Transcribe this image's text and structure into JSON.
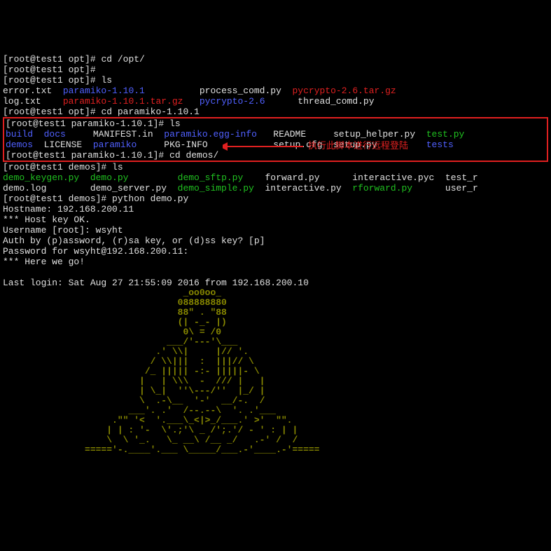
{
  "lines": {
    "l1_prompt": "[root@test1 opt]# ",
    "l1_cmd": "cd /opt/",
    "l2_prompt": "[root@test1 opt]# ",
    "l3_prompt": "[root@test1 opt]# ",
    "l3_cmd": "ls",
    "l4_a": "error.txt  ",
    "l4_b": "paramiko-1.10.1",
    "l4_c": "          process_comd.py  ",
    "l4_d": "pycrypto-2.6.tar.gz",
    "l5_a": "log.txt    ",
    "l5_b": "paramiko-1.10.1.tar.gz",
    "l5_c": "   ",
    "l5_d": "pycrypto-2.6",
    "l5_e": "      thread_comd.py",
    "l6_prompt": "[root@test1 opt]# ",
    "l6_cmd": "cd paramiko-1.10.1",
    "l7_prompt": "[root@test1 paramiko-1.10.1]# ",
    "l7_cmd": "ls",
    "l8_a": "build",
    "l8_b": "  ",
    "l8_c": "docs",
    "l8_d": "     MANIFEST.in  ",
    "l8_e": "paramiko.egg-info",
    "l8_f": "   README     setup_helper.py  ",
    "l8_g": "test.py",
    "l9_a": "demos",
    "l9_b": "  LICENSE  ",
    "l9_c": "paramiko",
    "l9_d": "     PKG-INFO            setup.cfg  setup.py         ",
    "l9_e": "tests",
    "l10_prompt": "[root@test1 paramiko-1.10.1]# ",
    "l10_cmd": "cd demos/",
    "l11_prompt": "[root@test1 demos]# ",
    "l11_cmd": "ls",
    "l12_a": "demo_keygen.py",
    "l12_b": "  ",
    "l12_c": "demo.py",
    "l12_d": "         ",
    "l12_e": "demo_sftp.py",
    "l12_f": "    forward.py      interactive.pyc  test_r",
    "l13_a": "demo.log        demo_server.py  ",
    "l13_b": "demo_simple.py",
    "l13_c": "  interactive.py  ",
    "l13_d": "rforward.py",
    "l13_e": "      user_r",
    "l14_prompt": "[root@test1 demos]# ",
    "l14_cmd": "python demo.py",
    "l15": "Hostname: 192.168.200.11",
    "l16": "*** Host key OK.",
    "l17": "Username [root]: wsyht",
    "l18": "Auth by (p)assword, (r)sa key, or (d)ss key? [p] ",
    "l19": "Password for wsyht@192.168.200.11: ",
    "l20": "*** Here we go!",
    "l21": "",
    "l22": "Last login: Sat Aug 27 21:55:09 2016 from 192.168.200.10"
  },
  "annotation": "执行此脚本进行远程登陆",
  "art": [
    "                                 _oo0oo_",
    "                                088888880",
    "                                88\" . \"88",
    "                                (| -_- |)",
    "                                 0\\ = /0",
    "                              ___/'---'\\___",
    "                            .' \\\\|     |// '.",
    "                           / \\\\|||  :  |||// \\",
    "                          /_ ||||| -:- |||||- \\",
    "                         |   | \\\\\\  -  /// |   |",
    "                         | \\_|  ''\\---/''  |_/ |",
    "                         \\  .-\\__  '-'  __/-.  /",
    "                       ___'. .'  /--.--\\  '. .'___",
    "                    .\"\" '<  '.___\\_<|>_/___.' >'  \"\".",
    "                   | | : '-  \\'.;'\\ _ /';.'/ - ' : | |",
    "                   \\  \\ '_.   \\_ __\\ /__ _/   .-' /  /",
    "               ====='-.____'.___ \\_____/___.-'____.-'====="
  ]
}
